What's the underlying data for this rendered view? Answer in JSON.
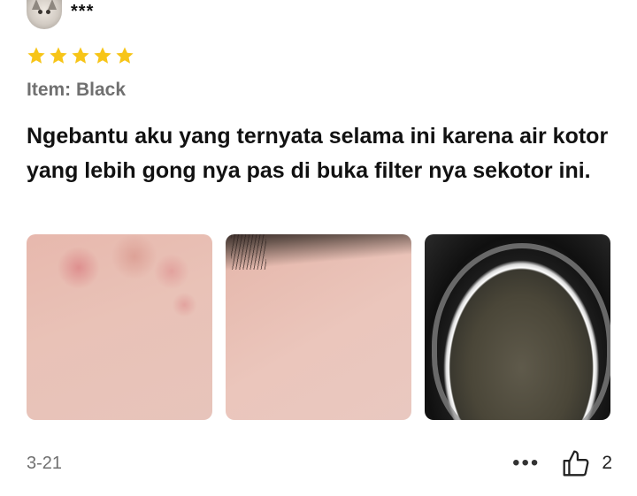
{
  "reviewer": {
    "username": "***",
    "avatar_icon": "cat-avatar"
  },
  "rating": {
    "value": 5,
    "max": 5,
    "star_color": "#f7c518"
  },
  "item_variant": "Item: Black",
  "review_text": "Ngebantu aku yang ternyata selama ini karena air kotor yang lebih gong nya pas di buka filter nya sekotor ini.",
  "photos": [
    {
      "name": "review-photo-skin-before"
    },
    {
      "name": "review-photo-skin-after"
    },
    {
      "name": "review-photo-dirty-filter"
    }
  ],
  "footer": {
    "date": "3-21",
    "more_icon": "more-options-icon",
    "like_icon": "thumbs-up-icon",
    "like_count": "2"
  }
}
